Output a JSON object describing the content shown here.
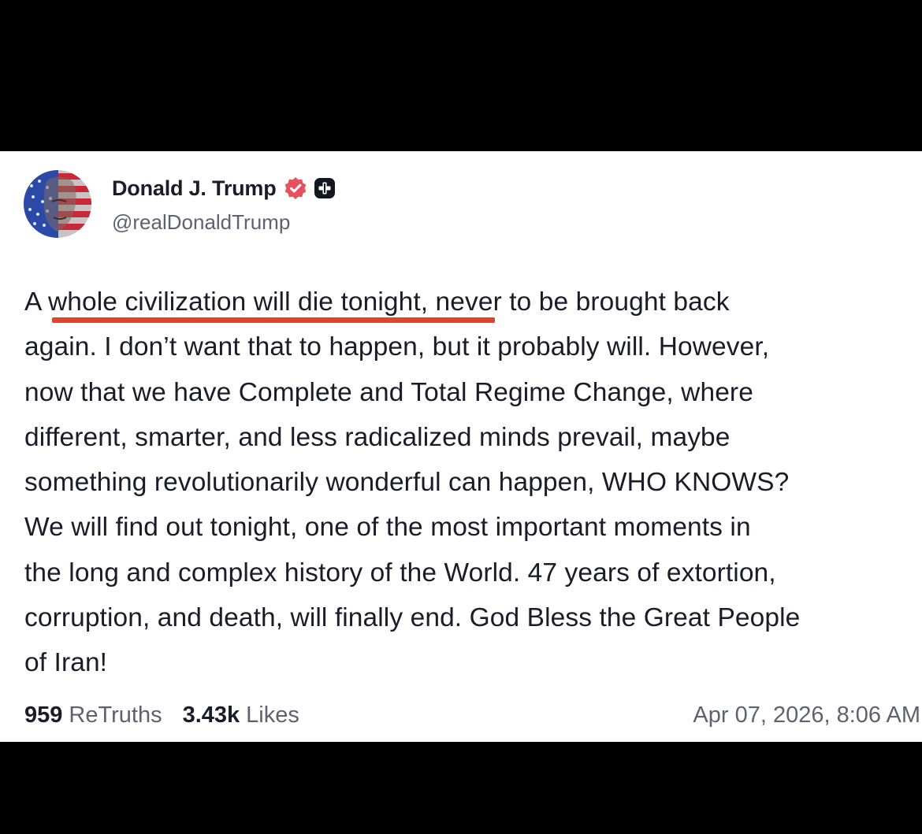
{
  "post": {
    "author_name": "Donald J. Trump",
    "author_handle": "@realDonaldTrump",
    "body_lines": [
      "A whole civilization will die tonight, never to be brought back",
      "again. I don’t want that to happen, but it probably will. However,",
      "now that we have Complete and Total Regime Change, where",
      "different, smarter, and less radicalized minds prevail, maybe",
      "something revolutionarily wonderful can happen, WHO KNOWS?",
      "We will find out tonight, one of the most important moments in",
      "the long and complex history of the World. 47 years of extortion,",
      "corruption, and death, will finally end. God Bless the Great People",
      "of Iran!"
    ],
    "retruths_count": "959",
    "retruths_label": "ReTruths",
    "likes_count": "3.43k",
    "likes_label": "Likes",
    "timestamp": "Apr 07, 2026, 8:06 AM"
  },
  "icons": {
    "verified": "verified-badge-icon",
    "premium": "premium-badge-icon",
    "avatar": "profile-avatar"
  },
  "colors": {
    "underline_highlight": "#e0452c",
    "verified_badge": "#e4515f",
    "text_primary": "#1b1b2a",
    "text_secondary": "#5f6170"
  }
}
